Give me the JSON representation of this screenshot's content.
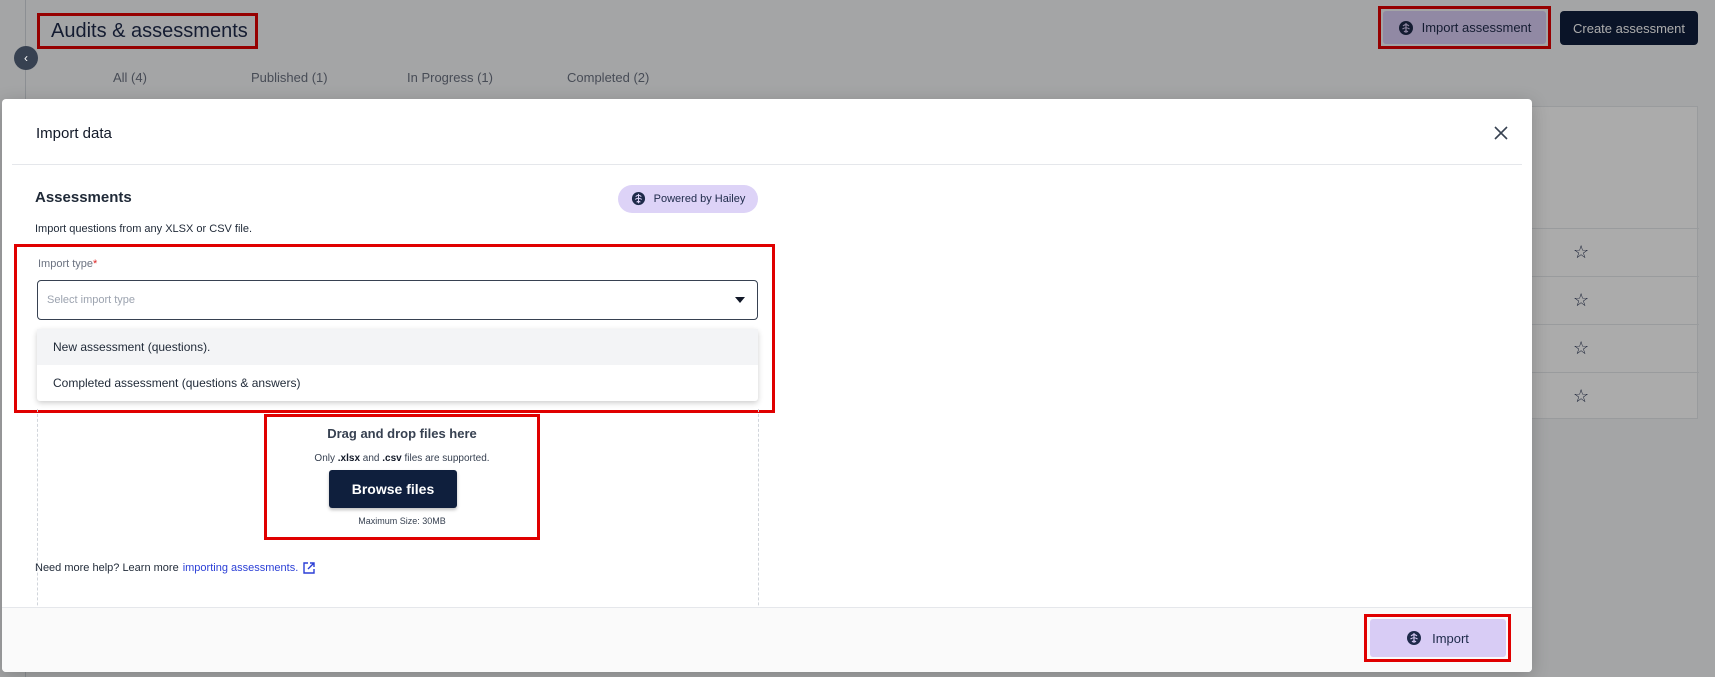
{
  "page": {
    "title": "Audits & assessments",
    "tabs": [
      {
        "label": "All (4)"
      },
      {
        "label": "Published (1)"
      },
      {
        "label": "In Progress (1)"
      },
      {
        "label": "Completed (2)"
      }
    ],
    "import_assessment_label": "Import assessment",
    "create_assessment_label": "Create assessment"
  },
  "modal": {
    "title": "Import data",
    "section_title": "Assessments",
    "powered_by": "Powered by Hailey",
    "description": "Import questions from any XLSX or CSV file.",
    "import_type": {
      "label": "Import type",
      "required_marker": "*",
      "placeholder": "Select import type",
      "options": [
        {
          "label": "New assessment (questions)."
        },
        {
          "label": "Completed assessment (questions & answers)"
        }
      ]
    },
    "drop": {
      "title": "Drag and drop files here",
      "formats_prefix": "Only ",
      "format_1": ".xlsx",
      "formats_and": " and ",
      "format_2": ".csv",
      "formats_suffix": " files are supported.",
      "browse_label": "Browse files",
      "max_size": "Maximum Size: 30MB"
    },
    "help_text": "Need more help? Learn more ",
    "help_link": "importing assessments.",
    "import_button": "Import"
  },
  "colors": {
    "accent_purple": "#d8ccf5",
    "navy": "#0f1f3d",
    "highlight_red": "#e00000",
    "link_blue": "#2b3fd6"
  },
  "icons": [
    "chevron-left-icon",
    "brain-icon",
    "close-icon",
    "caret-down-icon",
    "external-link-icon",
    "star-icon"
  ]
}
